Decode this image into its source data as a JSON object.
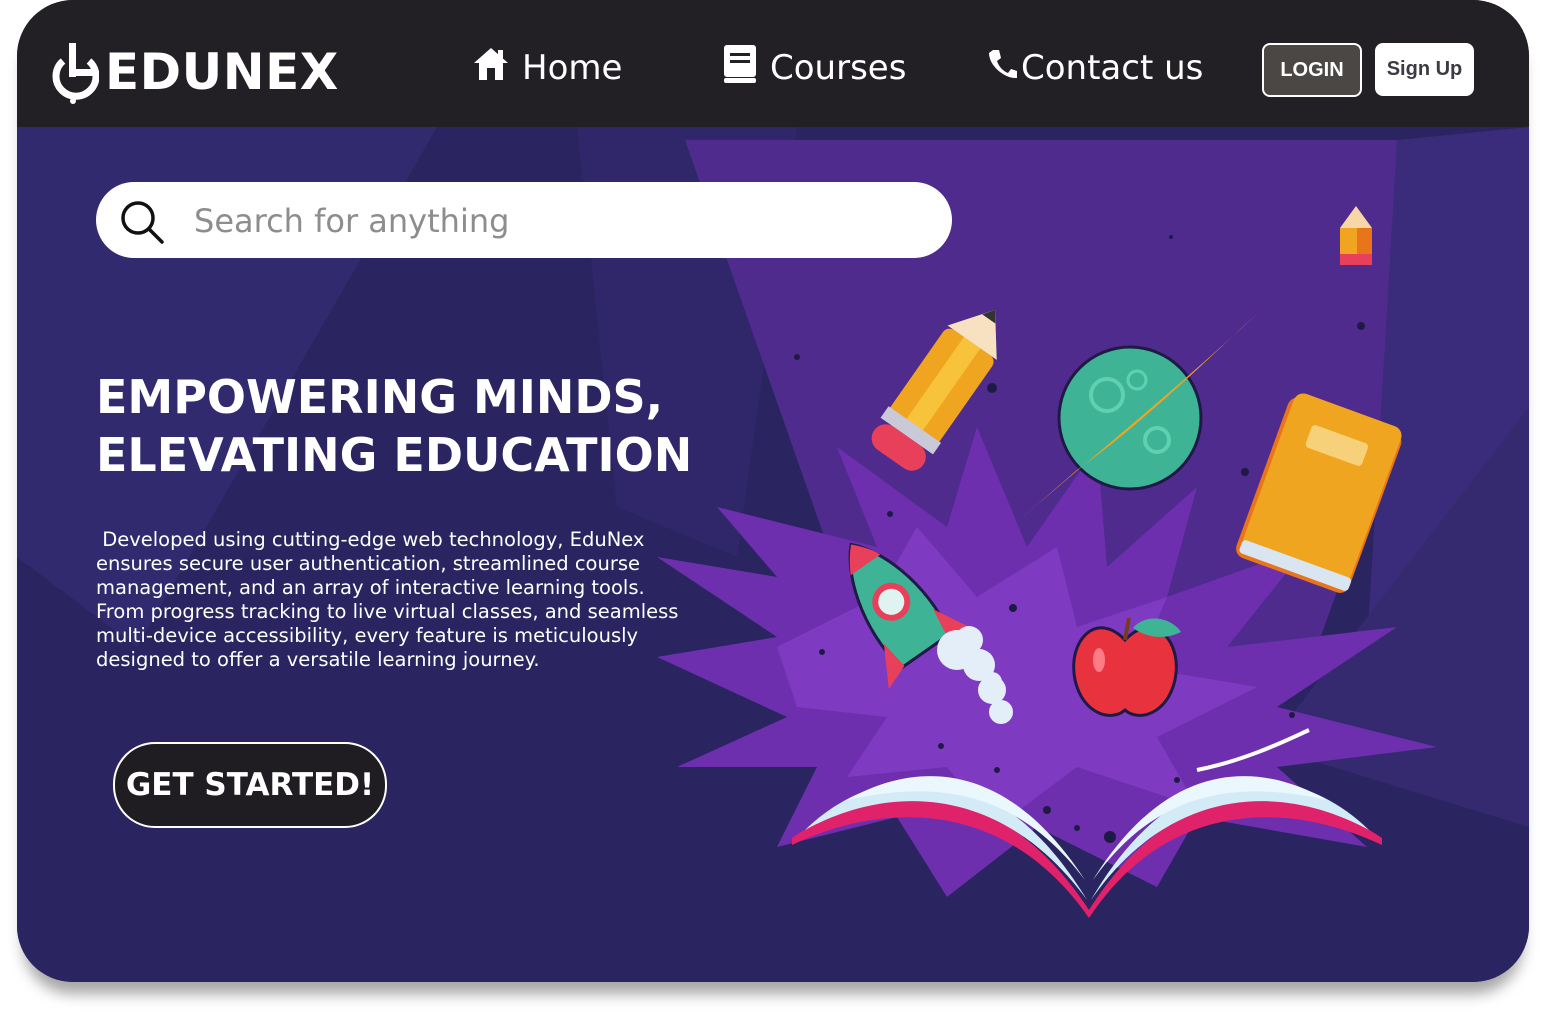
{
  "brand": {
    "name": "EDUNEX"
  },
  "nav": {
    "home": {
      "label": "Home",
      "icon": "home-icon"
    },
    "courses": {
      "label": "Courses",
      "icon": "book-icon"
    },
    "contact": {
      "label": "Contact us",
      "icon": "phone-icon"
    },
    "login_label": "LOGIN",
    "signup_label": "Sign Up"
  },
  "search": {
    "placeholder": "Search for anything",
    "value": "",
    "icon": "search-icon"
  },
  "hero": {
    "headline_line1": "EMPOWERING MINDS,",
    "headline_line2": "ELEVATING EDUCATION",
    "description": " Developed using cutting-edge web technology, EduNex ensures secure user authentication, streamlined course management, and an array of interactive learning tools. From progress tracking to live virtual classes, and seamless multi-device accessibility, every feature is meticulously designed to offer a versatile learning journey.",
    "cta_label": "GET STARTED!"
  },
  "colors": {
    "navbar": "#222025",
    "hero_background": "#2a2460",
    "hero_rays": "#4f2b8e",
    "burst": "#7a34b8",
    "book_accent": "#e0226b",
    "planet": "#3fb395",
    "book_cover": "#f0a521"
  }
}
